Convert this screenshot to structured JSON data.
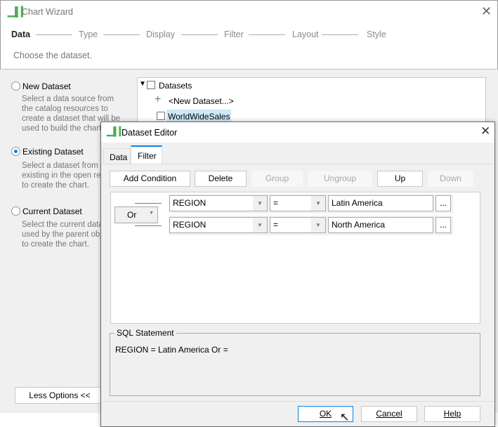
{
  "wizard": {
    "title": "Chart Wizard",
    "steps": [
      "Data",
      "Type",
      "Display",
      "Filter",
      "Layout",
      "Style"
    ],
    "instruction": "Choose the dataset.",
    "options": [
      {
        "label": "New Dataset",
        "desc": "Select a data source from the catalog resources to create a dataset that will be used to build the chart.",
        "selected": false
      },
      {
        "label": "Existing Dataset",
        "desc": "Select a dataset from the existing in the open report to create the chart.",
        "selected": true
      },
      {
        "label": "Current Dataset",
        "desc": "Select the current dataset used by the parent object to create the chart.",
        "selected": false
      }
    ],
    "tree": {
      "root": "Datasets",
      "items": [
        "<New Dataset...>",
        "WorldWideSales"
      ]
    },
    "less_options": "Less Options <<"
  },
  "editor": {
    "title": "Dataset Editor",
    "tabs": [
      "Data",
      "Filter"
    ],
    "active_tab": "Filter",
    "toolbar": {
      "add": "Add Condition",
      "delete": "Delete",
      "group": "Group",
      "ungroup": "Ungroup",
      "up": "Up",
      "down": "Down"
    },
    "logic": "Or",
    "conditions": [
      {
        "field": "REGION",
        "op": "=",
        "value": "Latin America",
        "more": "..."
      },
      {
        "field": "REGION",
        "op": "=",
        "value": "North America",
        "more": "..."
      }
    ],
    "sql_label": "SQL Statement",
    "sql": "REGION = Latin America Or  =",
    "ok": "OK",
    "cancel": "Cancel",
    "help": "Help"
  },
  "colors": {
    "accent": "#0a84e0",
    "icon_green": "#4caf50"
  }
}
